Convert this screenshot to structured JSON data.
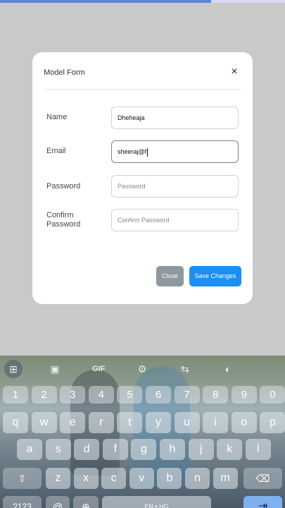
{
  "modal": {
    "title": "Model Form",
    "close_icon": "×",
    "fields": {
      "name": {
        "label": "Name",
        "value": "Dheheaja"
      },
      "email": {
        "label": "Email",
        "value": "sheeraj@f"
      },
      "password": {
        "label": "Password",
        "placeholder": "Password"
      },
      "confirm": {
        "label_line1": "Confirm",
        "label_line2": "Password",
        "placeholder": "Confirm Password"
      }
    },
    "buttons": {
      "close": "Close",
      "save": "Save Changes"
    }
  },
  "keyboard": {
    "toolbar": {
      "grid": "⊞",
      "sticker": "▣",
      "gif": "GIF",
      "settings": "⚙",
      "translate": "⇆",
      "theme": "◐"
    },
    "numbers": [
      "1",
      "2",
      "3",
      "4",
      "5",
      "6",
      "7",
      "8",
      "9",
      "0"
    ],
    "row1": [
      "q",
      "w",
      "e",
      "r",
      "t",
      "y",
      "u",
      "i",
      "o",
      "p"
    ],
    "row2": [
      "a",
      "s",
      "d",
      "f",
      "g",
      "h",
      "j",
      "k",
      "l"
    ],
    "row3": [
      "z",
      "x",
      "c",
      "v",
      "b",
      "n",
      "m"
    ],
    "shift": "⇧",
    "backspace": "⌫",
    "symbols": "?123",
    "at": "@",
    "globe": "⊕",
    "space": "EN • HG",
    "enter": "⇥"
  },
  "colors": {
    "accent": "#1c8ef4",
    "close_button": "#8e989f"
  }
}
